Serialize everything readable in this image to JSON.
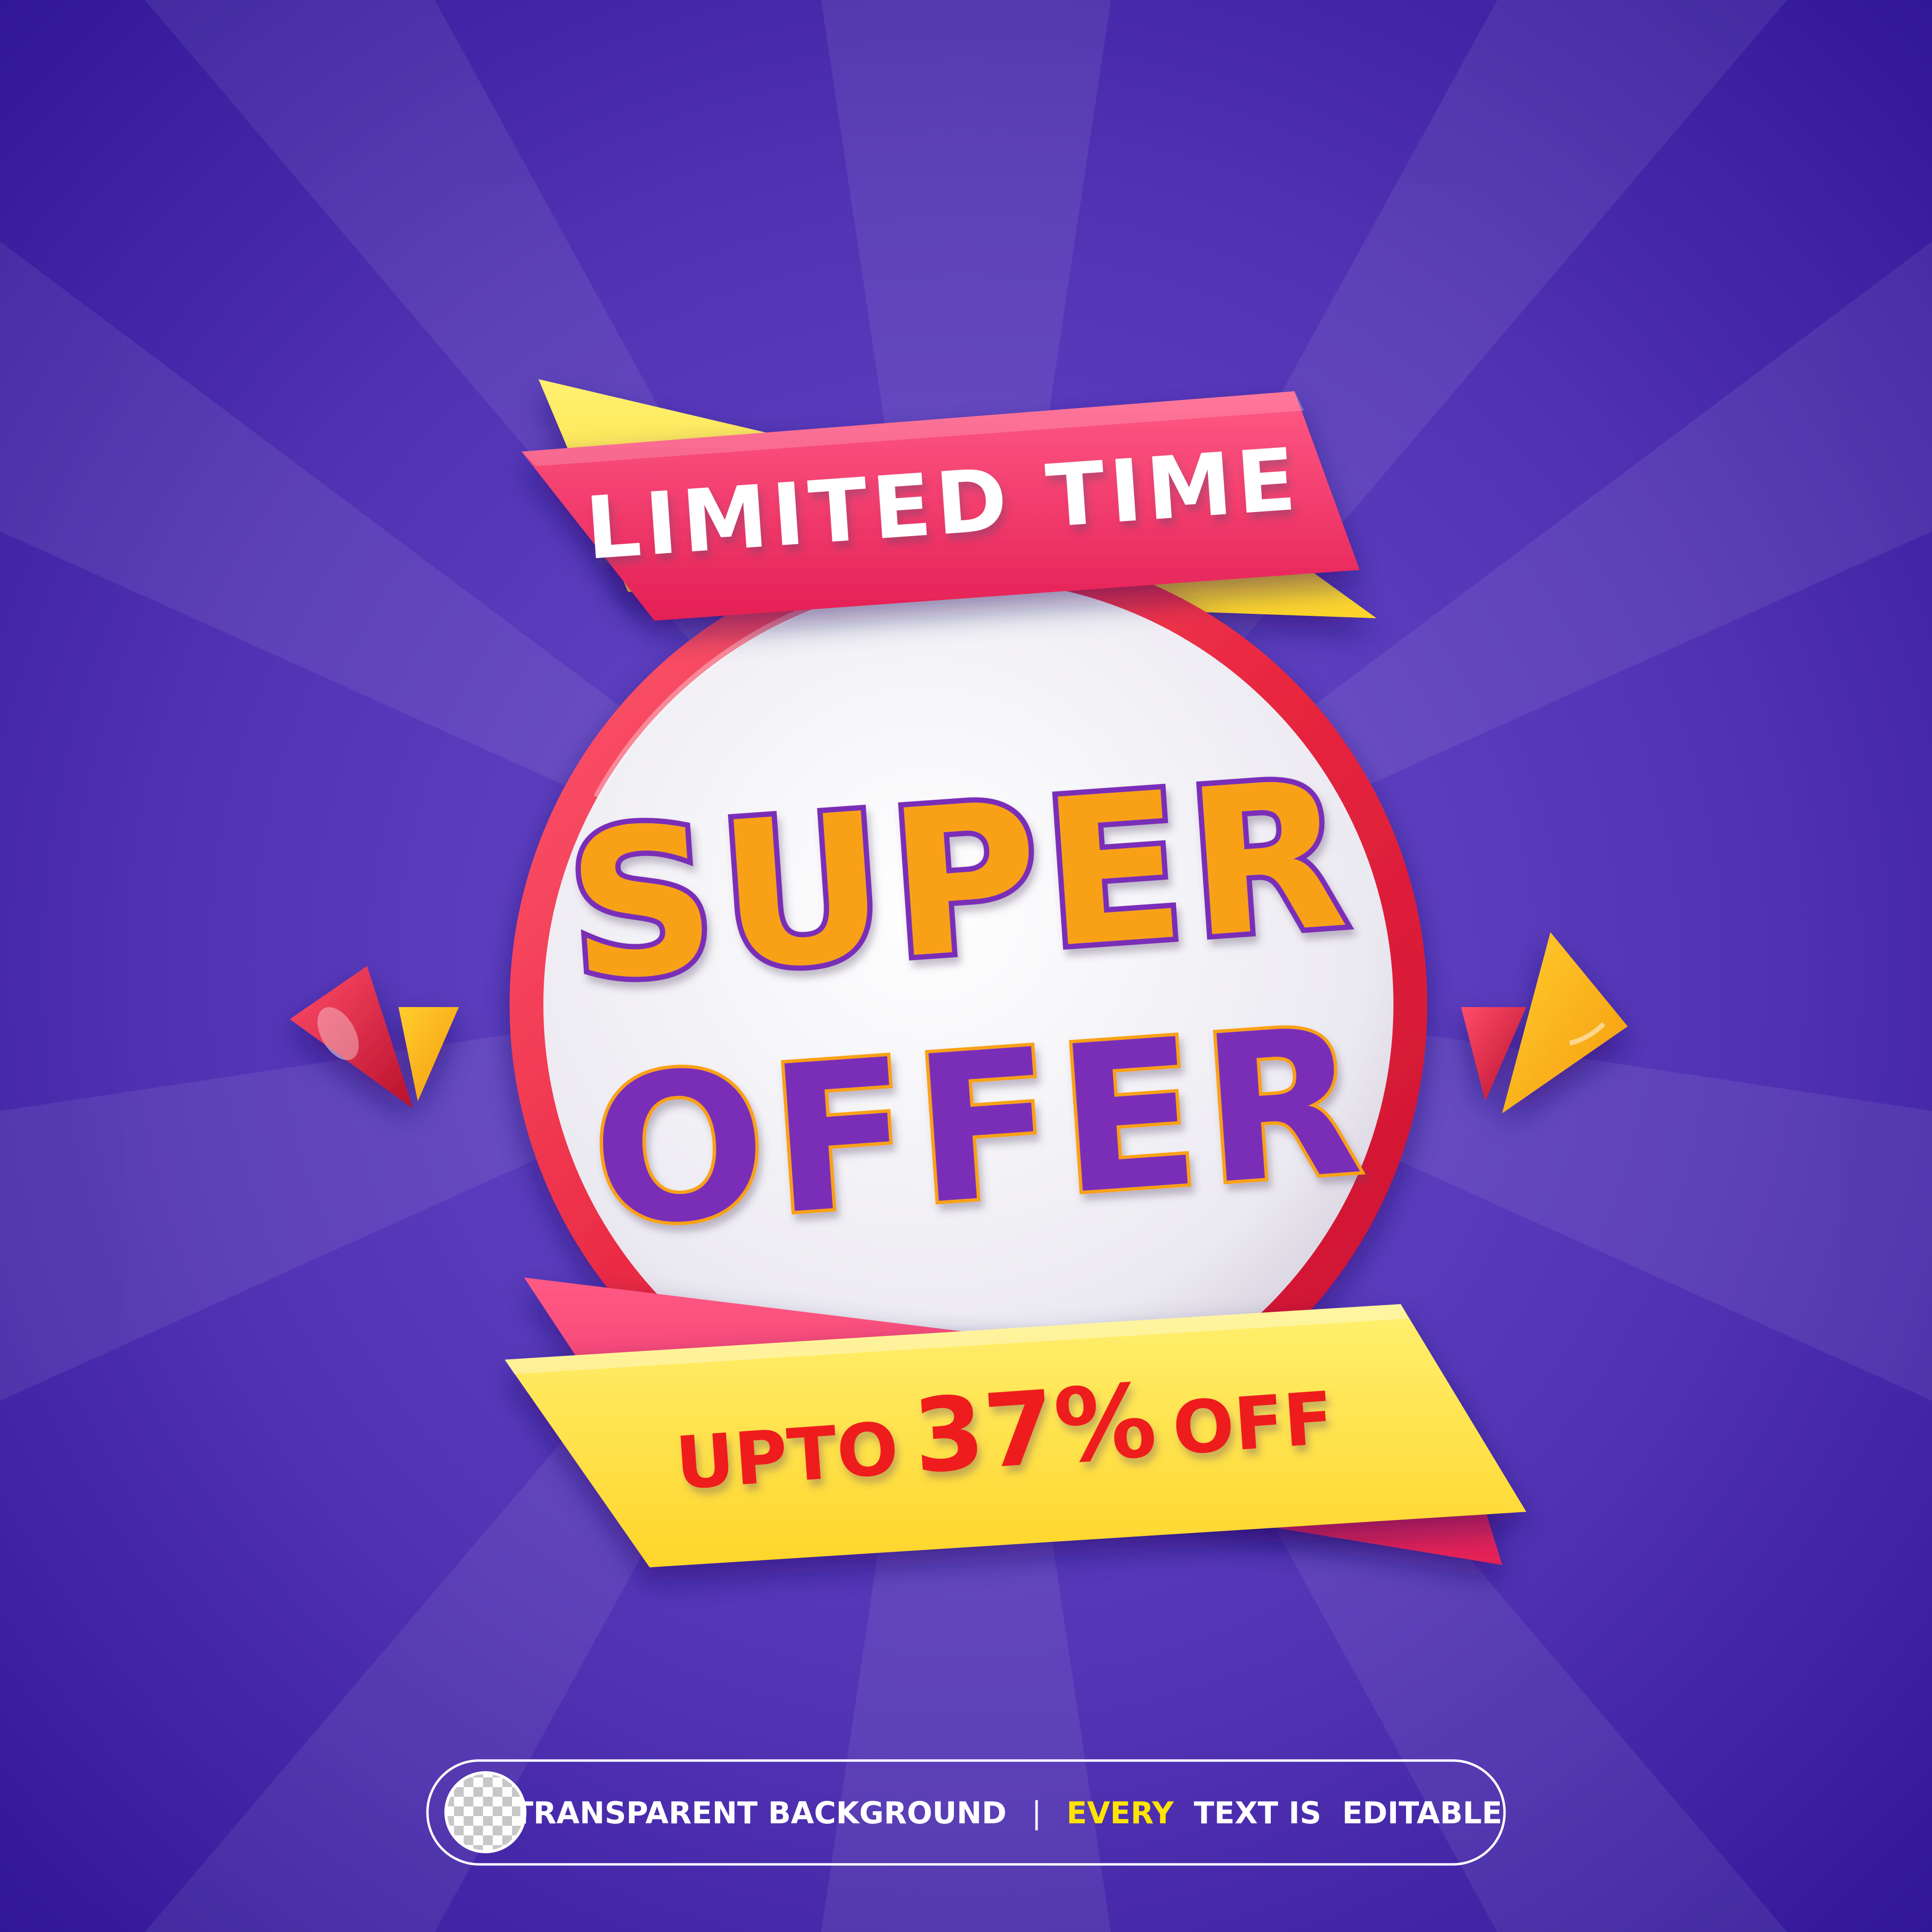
{
  "colors": {
    "background_center": "#6547c8",
    "background_edge": "#2e1694",
    "ribbon_pink": "#f0305f",
    "ribbon_yellow": "#ffdd44",
    "ring_red": "#ec3a4a",
    "super_fill": "#f9a114",
    "super_outline": "#7a2fb8",
    "offer_fill": "#7a2fb8",
    "offer_outline": "#f9a114",
    "discount_red": "#ee1b1b",
    "badge_every": "#ffe400"
  },
  "banner": {
    "top_ribbon_text": "LIMITED TIME",
    "headline_line1": "SUPER",
    "headline_line2": "OFFER",
    "discount_prefix": "UPTO",
    "discount_value": "37%",
    "discount_suffix": "OFF"
  },
  "footer_badge": {
    "icon": "transparency-checker-icon",
    "left_text": "TRANSPARENT BACKGROUND",
    "separator": "|",
    "highlight_word": "EVERY",
    "right_text": "TEXT IS  EDITABLE"
  }
}
